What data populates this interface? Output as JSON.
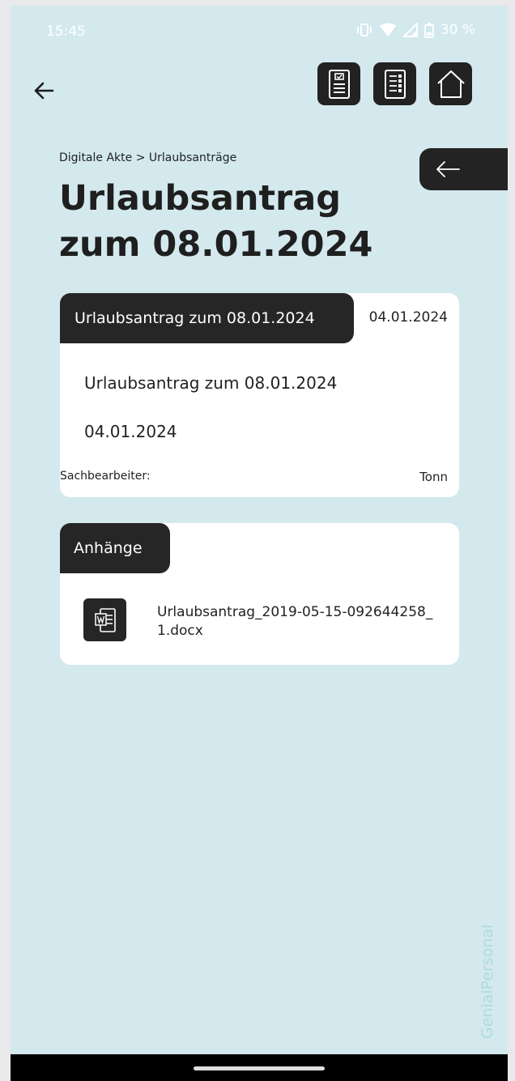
{
  "status": {
    "time": "15:45",
    "battery": "30 %"
  },
  "breadcrumb": "Digitale Akte > Urlaubsanträge",
  "page_title": "Urlaubsantrag zum 08.01.2024",
  "detail_card": {
    "header": "Urlaubsantrag zum 08.01.2024",
    "date": "04.01.2024",
    "title_line": "Urlaubsantrag zum 08.01.2024",
    "date_line": "04.01.2024",
    "label": "Sachbearbeiter:",
    "value": "Tonn"
  },
  "attachments": {
    "header": "Anhänge",
    "items": [
      {
        "name": "Urlaubsantrag_2019-05-15-092644258_1.docx",
        "icon": "word-document-icon"
      }
    ]
  },
  "watermark": "GenialPersonal",
  "icons": {
    "back": "back-arrow-icon",
    "toolbar": [
      "checklist-icon",
      "list-document-icon",
      "home-icon"
    ],
    "side_back": "back-arrow-icon"
  },
  "colors": {
    "background": "#d3e9ee",
    "dark": "#262626",
    "card": "#ffffff",
    "watermark": "#aedbe0"
  }
}
